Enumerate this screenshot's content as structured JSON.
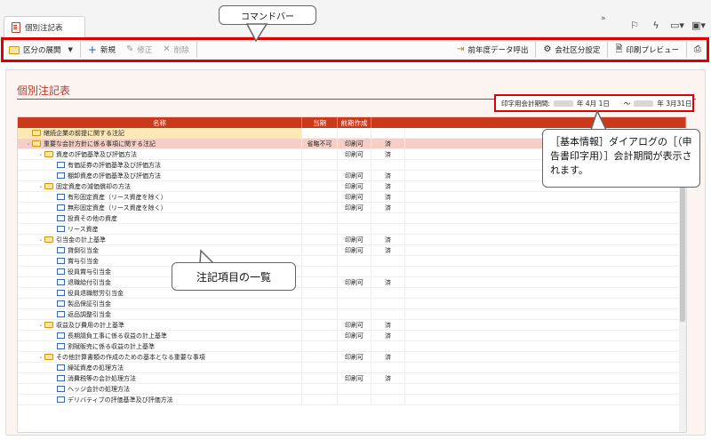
{
  "window": {
    "tab_label": "個別注記表"
  },
  "toolbar": {
    "expand_label": "区分の展開",
    "new_label": "新規",
    "edit_label": "修正",
    "delete_label": "削除",
    "prev_year_label": "前年度データ呼出",
    "company_setting_label": "会社区分設定",
    "print_preview_label": "印刷プレビュー"
  },
  "page": {
    "title": "個別注記表",
    "period_label": "印字用会計期間:",
    "period_start": "年 4月 1日",
    "period_tilde": "〜",
    "period_end": "年 3月31日"
  },
  "table": {
    "headers": [
      "名称",
      "当期",
      "前期作成"
    ],
    "rows": [
      {
        "indent": 0,
        "type": "folder",
        "name": "継続企業の前提に関する注記",
        "a": "",
        "b": "",
        "first": true
      },
      {
        "indent": 0,
        "type": "folder",
        "name": "重要な会計方針に係る事項に関する注記",
        "a": "省略不可",
        "b": "印刷可",
        "c": "済",
        "sel": true
      },
      {
        "indent": 1,
        "type": "folder",
        "name": "資産の評価基準及び評価方法",
        "a": "",
        "b": "印刷可",
        "c": "済"
      },
      {
        "indent": 2,
        "type": "doc",
        "name": "有価証券の評価基準及び評価方法",
        "a": "",
        "b": "",
        "c": ""
      },
      {
        "indent": 2,
        "type": "doc",
        "name": "棚卸資産の評価基準及び評価方法",
        "a": "",
        "b": "印刷可",
        "c": "済"
      },
      {
        "indent": 1,
        "type": "folder",
        "name": "固定資産の減価償却の方法",
        "a": "",
        "b": "印刷可",
        "c": "済"
      },
      {
        "indent": 2,
        "type": "doc",
        "name": "有形固定資産（リース資産を除く）",
        "a": "",
        "b": "印刷可",
        "c": "済"
      },
      {
        "indent": 2,
        "type": "doc",
        "name": "無形固定資産（リース資産を除く）",
        "a": "",
        "b": "印刷可",
        "c": "済"
      },
      {
        "indent": 2,
        "type": "doc",
        "name": "投資その他の資産",
        "a": "",
        "b": "",
        "c": ""
      },
      {
        "indent": 2,
        "type": "doc",
        "name": "リース資産",
        "a": "",
        "b": "",
        "c": ""
      },
      {
        "indent": 1,
        "type": "folder",
        "name": "引当金の計上基準",
        "a": "",
        "b": "印刷可",
        "c": "済"
      },
      {
        "indent": 2,
        "type": "doc",
        "name": "貸倒引当金",
        "a": "",
        "b": "印刷可",
        "c": "済"
      },
      {
        "indent": 2,
        "type": "doc",
        "name": "賞与引当金",
        "a": "",
        "b": "",
        "c": ""
      },
      {
        "indent": 2,
        "type": "doc",
        "name": "役員賞与引当金",
        "a": "",
        "b": "",
        "c": ""
      },
      {
        "indent": 2,
        "type": "doc",
        "name": "退職給付引当金",
        "a": "",
        "b": "印刷可",
        "c": "済"
      },
      {
        "indent": 2,
        "type": "doc",
        "name": "役員退職慰労引当金",
        "a": "",
        "b": "",
        "c": ""
      },
      {
        "indent": 2,
        "type": "doc",
        "name": "製品保証引当金",
        "a": "",
        "b": "",
        "c": ""
      },
      {
        "indent": 2,
        "type": "doc",
        "name": "返品調整引当金",
        "a": "",
        "b": "",
        "c": ""
      },
      {
        "indent": 1,
        "type": "folder",
        "name": "収益及び費用の計上基準",
        "a": "",
        "b": "印刷可",
        "c": "済"
      },
      {
        "indent": 2,
        "type": "doc",
        "name": "長期請負工事に係る収益の計上基準",
        "a": "",
        "b": "印刷可",
        "c": "済"
      },
      {
        "indent": 2,
        "type": "doc",
        "name": "割賦販売に係る収益の計上基準",
        "a": "",
        "b": "",
        "c": ""
      },
      {
        "indent": 1,
        "type": "folder",
        "name": "その他計算書類の作成のための基本となる重要な事項",
        "a": "",
        "b": "印刷可",
        "c": "済"
      },
      {
        "indent": 2,
        "type": "doc",
        "name": "繰延資産の処理方法",
        "a": "",
        "b": "",
        "c": ""
      },
      {
        "indent": 2,
        "type": "doc",
        "name": "消費税等の会計処理方法",
        "a": "",
        "b": "印刷可",
        "c": "済"
      },
      {
        "indent": 2,
        "type": "doc",
        "name": "ヘッジ会計の処理方法",
        "a": "",
        "b": "",
        "c": ""
      },
      {
        "indent": 2,
        "type": "doc",
        "name": "デリバティブの評価基準及び評価方法",
        "a": "",
        "b": "",
        "c": ""
      }
    ]
  },
  "callouts": {
    "command_bar": "コマンドバー",
    "list": "注記項目の一覧",
    "period": "［基本情報］ダイアログの［（申告書印字用）］会計期間が表示されます。"
  }
}
